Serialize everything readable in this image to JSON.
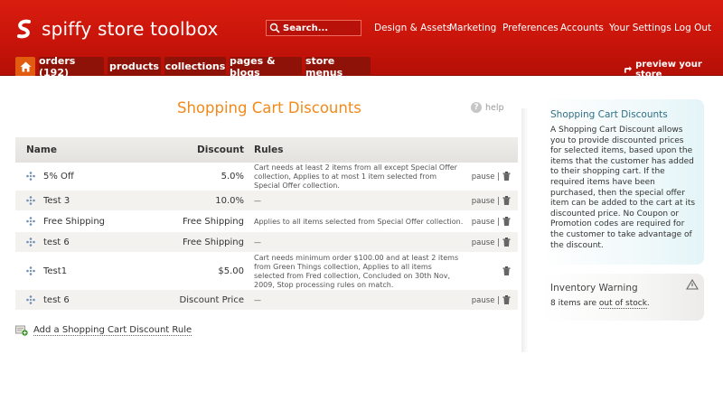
{
  "app": {
    "title": "spiffy store toolbox"
  },
  "search": {
    "placeholder": "Search..."
  },
  "topnav": [
    "Design & Assets",
    "Marketing",
    "Preferences",
    "Accounts",
    "Your Settings",
    "Log Out"
  ],
  "tabs": [
    "orders (192)",
    "products",
    "collections",
    "pages & blogs",
    "store menus"
  ],
  "preview_label": "preview your store",
  "page": {
    "title": "Shopping Cart Discounts",
    "help_label": "help"
  },
  "table": {
    "headers": {
      "name": "Name",
      "discount": "Discount",
      "rules": "Rules"
    },
    "rows": [
      {
        "name": "5% Off",
        "discount": "5.0%",
        "rules": "Cart needs at least 2 items from all except Special Offer collection, Applies to at most 1 item selected from Special Offer collection.",
        "pause": "pause |"
      },
      {
        "name": "Test 3",
        "discount": "10.0%",
        "rules": "—",
        "pause": "pause |"
      },
      {
        "name": "Free Shipping",
        "discount": "Free Shipping",
        "rules": "Applies to all items selected from Special Offer collection.",
        "pause": "pause |"
      },
      {
        "name": "test 6",
        "discount": "Free Shipping",
        "rules": "—",
        "pause": "pause |"
      },
      {
        "name": "Test1",
        "discount": "$5.00",
        "rules": "Cart needs minimum order $100.00 and at least 2 items from Green Things collection, Applies to all items selected from Fred collection, Concluded on 30th Nov, 2009, Stop processing rules on match.",
        "pause": ""
      },
      {
        "name": "test 6",
        "discount": "Discount Price",
        "rules": "—",
        "pause": "pause |"
      }
    ]
  },
  "add_rule_label": "Add a Shopping Cart Discount Rule",
  "sidebar": {
    "discount_panel": {
      "title": "Shopping Cart Discounts",
      "body": "A Shopping Cart Discount allows you to provide discounted prices for selected items, based upon the items that the customer has added to their shopping cart. If the required items have been purchased, then the special offer item can be added to the cart at its discounted price. No Coupon or Promotion codes are required for the customer to take advantage of the discount."
    },
    "inventory_panel": {
      "title": "Inventory Warning",
      "text_before": "8 items are ",
      "link": "out of stock",
      "text_after": "."
    }
  },
  "colors": {
    "header": "#c8140a",
    "tab": "#8f1208",
    "home_tab": "#e25c10",
    "title": "#f28a1a",
    "panel_title": "#2e6f86"
  },
  "icons": [
    "logo-s-icon",
    "search-icon",
    "home-icon",
    "preview-arrow-icon",
    "help-icon",
    "drag-handle-icon",
    "trash-icon",
    "add-rule-icon",
    "warning-icon"
  ]
}
